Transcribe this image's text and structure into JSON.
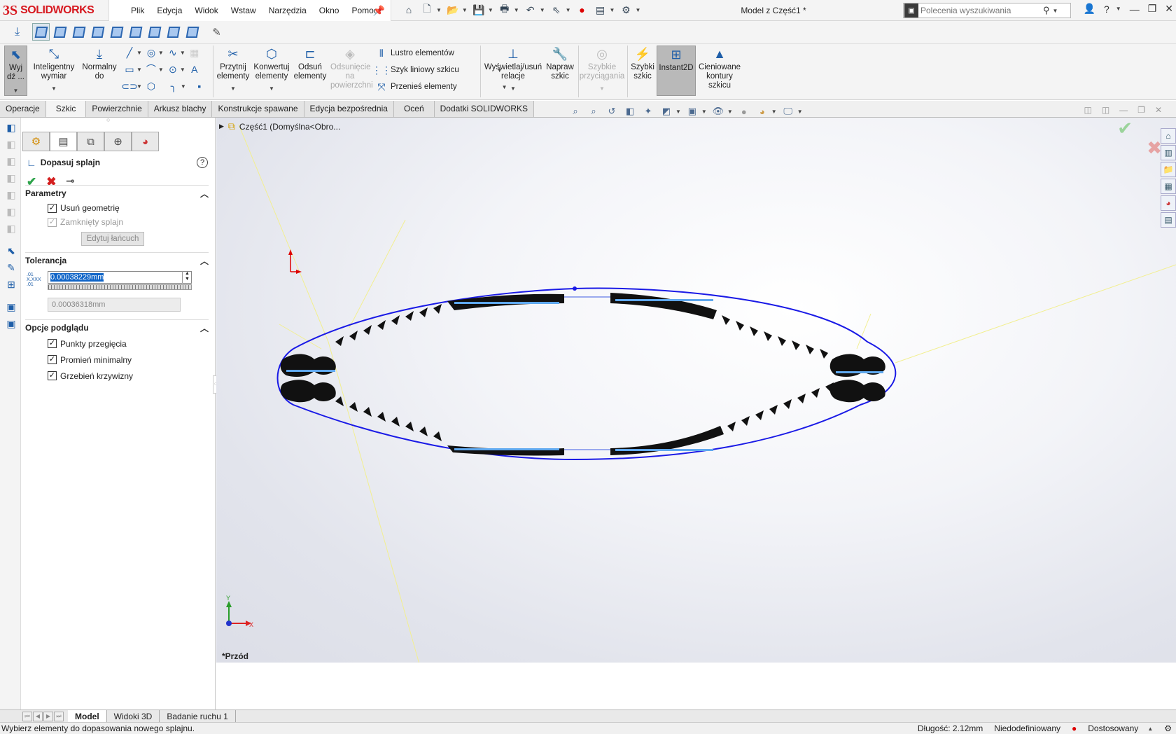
{
  "app": {
    "brand": "SOLIDWORKS",
    "document_title": "Model z Część1 *"
  },
  "menu": [
    "Plik",
    "Edycja",
    "Widok",
    "Wstaw",
    "Narzędzia",
    "Okno",
    "Pomoc"
  ],
  "search": {
    "placeholder": "Polecenia wyszukiwania"
  },
  "ribbon": {
    "exit": "Wyj dź ...",
    "smart_dim": "Inteligentny wymiar",
    "normal_to": "Normalny do",
    "trim": "Przytnij elementy",
    "convert": "Konwertuj elementy",
    "offset": "Odsuń elementy",
    "offset_surface": "Odsunięcie na powierzchni",
    "mirror": "Lustro elementów",
    "linear_pattern": "Szyk liniowy szkicu",
    "move": "Przenieś elementy",
    "relations": "Wyświetlaj/usuń relacje",
    "repair": "Napraw szkic",
    "quick_snaps": "Szybkie przyciągania",
    "rapid_sketch": "Szybki szkic",
    "instant2d": "Instant2D",
    "shaded_contours": "Cieniowane kontury szkicu"
  },
  "tabs": [
    "Operacje",
    "Szkic",
    "Powierzchnie",
    "Arkusz blachy",
    "Konstrukcje spawane",
    "Edycja bezpośrednia",
    "Oceń",
    "Dodatki SOLIDWORKS"
  ],
  "active_tab": "Szkic",
  "property_manager": {
    "title": "Dopasuj splajn",
    "params": {
      "heading": "Parametry",
      "delete_geometry": "Usuń geometrię",
      "closed_spline": "Zamknięty splajn",
      "edit_chain": "Edytuj łańcuch"
    },
    "tolerance": {
      "heading": "Tolerancja",
      "value": "0.00038229mm",
      "actual": "0.00036318mm"
    },
    "preview": {
      "heading": "Opcje podglądu",
      "inflection": "Punkty przegięcia",
      "min_radius": "Promień minimalny",
      "curvature_comb": "Grzebień krzywizny"
    }
  },
  "tree_root": "Część1  (Domyślna<Obro...",
  "view_label": "*Przód",
  "bottom_tabs": [
    "Model",
    "Widoki 3D",
    "Badanie ruchu 1"
  ],
  "status": {
    "message": "Wybierz elementy do dopasowania nowego splajnu.",
    "length": "Długość: 2.12mm",
    "state": "Niedodefiniowany",
    "units": "Dostosowany"
  },
  "colors": {
    "accent": "#1e5ea8",
    "brand": "#d71920",
    "spline": "#1a1ae6",
    "comb": "#000000"
  }
}
